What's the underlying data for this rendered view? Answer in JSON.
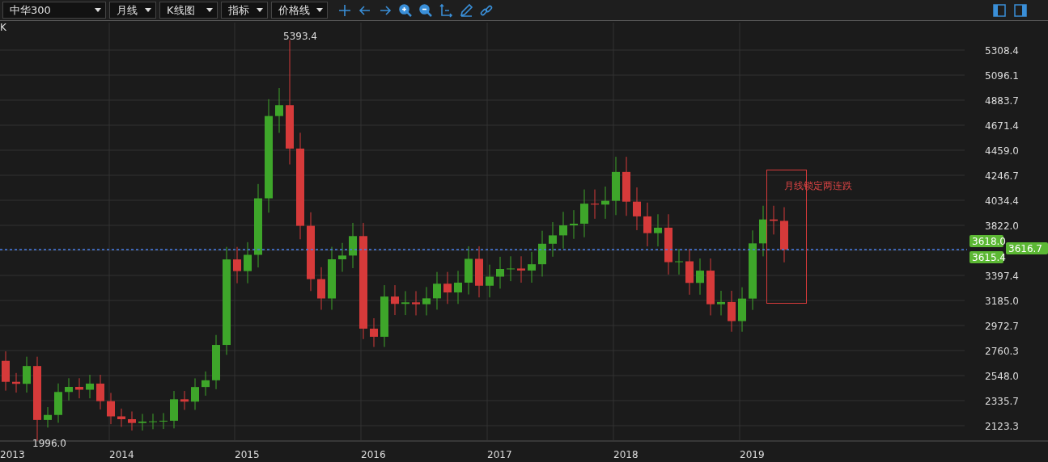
{
  "toolbar": {
    "dropdowns": [
      {
        "value": "中华300"
      },
      {
        "value": "月线"
      },
      {
        "value": "K线图"
      },
      {
        "value": "指标"
      },
      {
        "value": "价格线"
      }
    ]
  },
  "chart": {
    "label": "K",
    "y_axis_labels": [
      "5308.4",
      "5096.1",
      "4883.7",
      "4671.4",
      "4459.0",
      "4246.7",
      "4034.4",
      "3822.0",
      "3397.4",
      "3185.0",
      "2972.7",
      "2760.3",
      "2548.0",
      "2335.7",
      "2123.3"
    ],
    "x_axis_labels": [
      "2013",
      "2014",
      "2015",
      "2016",
      "2017",
      "2018",
      "2019"
    ],
    "high_label": "5393.4",
    "low_label": "1996.0",
    "annotation": "月线锁定两连跌",
    "price_tags": [
      {
        "text": "3618.0",
        "kind": "side"
      },
      {
        "text": "3616.7",
        "kind": "last"
      },
      {
        "text": "3615.4",
        "kind": "side"
      }
    ]
  }
}
